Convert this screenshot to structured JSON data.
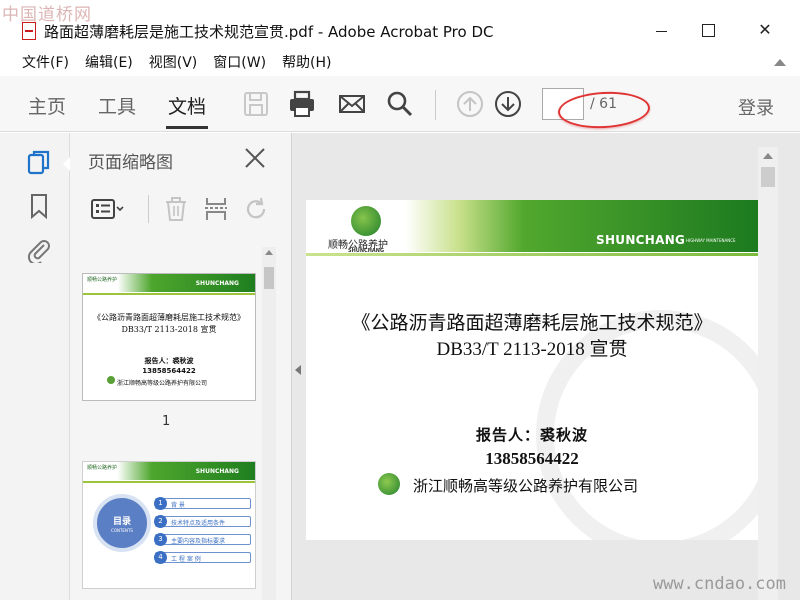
{
  "window": {
    "title": "路面超薄磨耗层是施工技术规范宣贯.pdf - Adobe Acrobat Pro DC"
  },
  "watermarks": {
    "top": "中国道桥网",
    "bottom": "www.cndao.com"
  },
  "menu": [
    "文件(F)",
    "编辑(E)",
    "视图(V)",
    "窗口(W)",
    "帮助(H)"
  ],
  "toolbar": {
    "tabs": [
      "主页",
      "工具",
      "文档"
    ],
    "active_tab": "文档",
    "page_current": "",
    "page_total": "/ 61",
    "login": "登录"
  },
  "thumbnail_panel": {
    "title": "页面缩略图",
    "page1_number": "1",
    "thumb1": {
      "brand": "SHUNCHANG",
      "logo": "顺畅公路养护",
      "line1": "《公路沥青路面超薄磨耗层施工技术规范》",
      "line2": "DB33/T 2113-2018  宣贯",
      "line3": "报告人：裘秋波",
      "line4": "13858564422",
      "line5": "浙江顺畅高等级公路养护有限公司"
    },
    "thumb2": {
      "brand": "SHUNCHANG",
      "logo": "顺畅公路养护",
      "circle_title": "目录",
      "circle_sub": "CONTENTS",
      "items": [
        {
          "n": "1",
          "label": "背 景"
        },
        {
          "n": "2",
          "label": "技术特点及适用条件"
        },
        {
          "n": "3",
          "label": "主要内容及指标要求"
        },
        {
          "n": "4",
          "label": "工 程 案 例"
        }
      ]
    }
  },
  "document_page": {
    "logo_cn": "顺畅公路养护",
    "logo_en": "SHUNCHANG",
    "brand": "SHUNCHANG",
    "brand_sub": "HIGHWAY MAINTENANCE",
    "title": "《公路沥青路面超薄磨耗层施工技术规范》",
    "subtitle": "DB33/T 2113-2018   宣贯",
    "reporter": "报告人：裘秋波",
    "phone": "13858564422",
    "company": "浙江顺畅高等级公路养护有限公司"
  },
  "colors": {
    "brand_green": "#1f7e1f",
    "annotation_red": "#e03434",
    "toc_blue": "#3a6fc3"
  }
}
